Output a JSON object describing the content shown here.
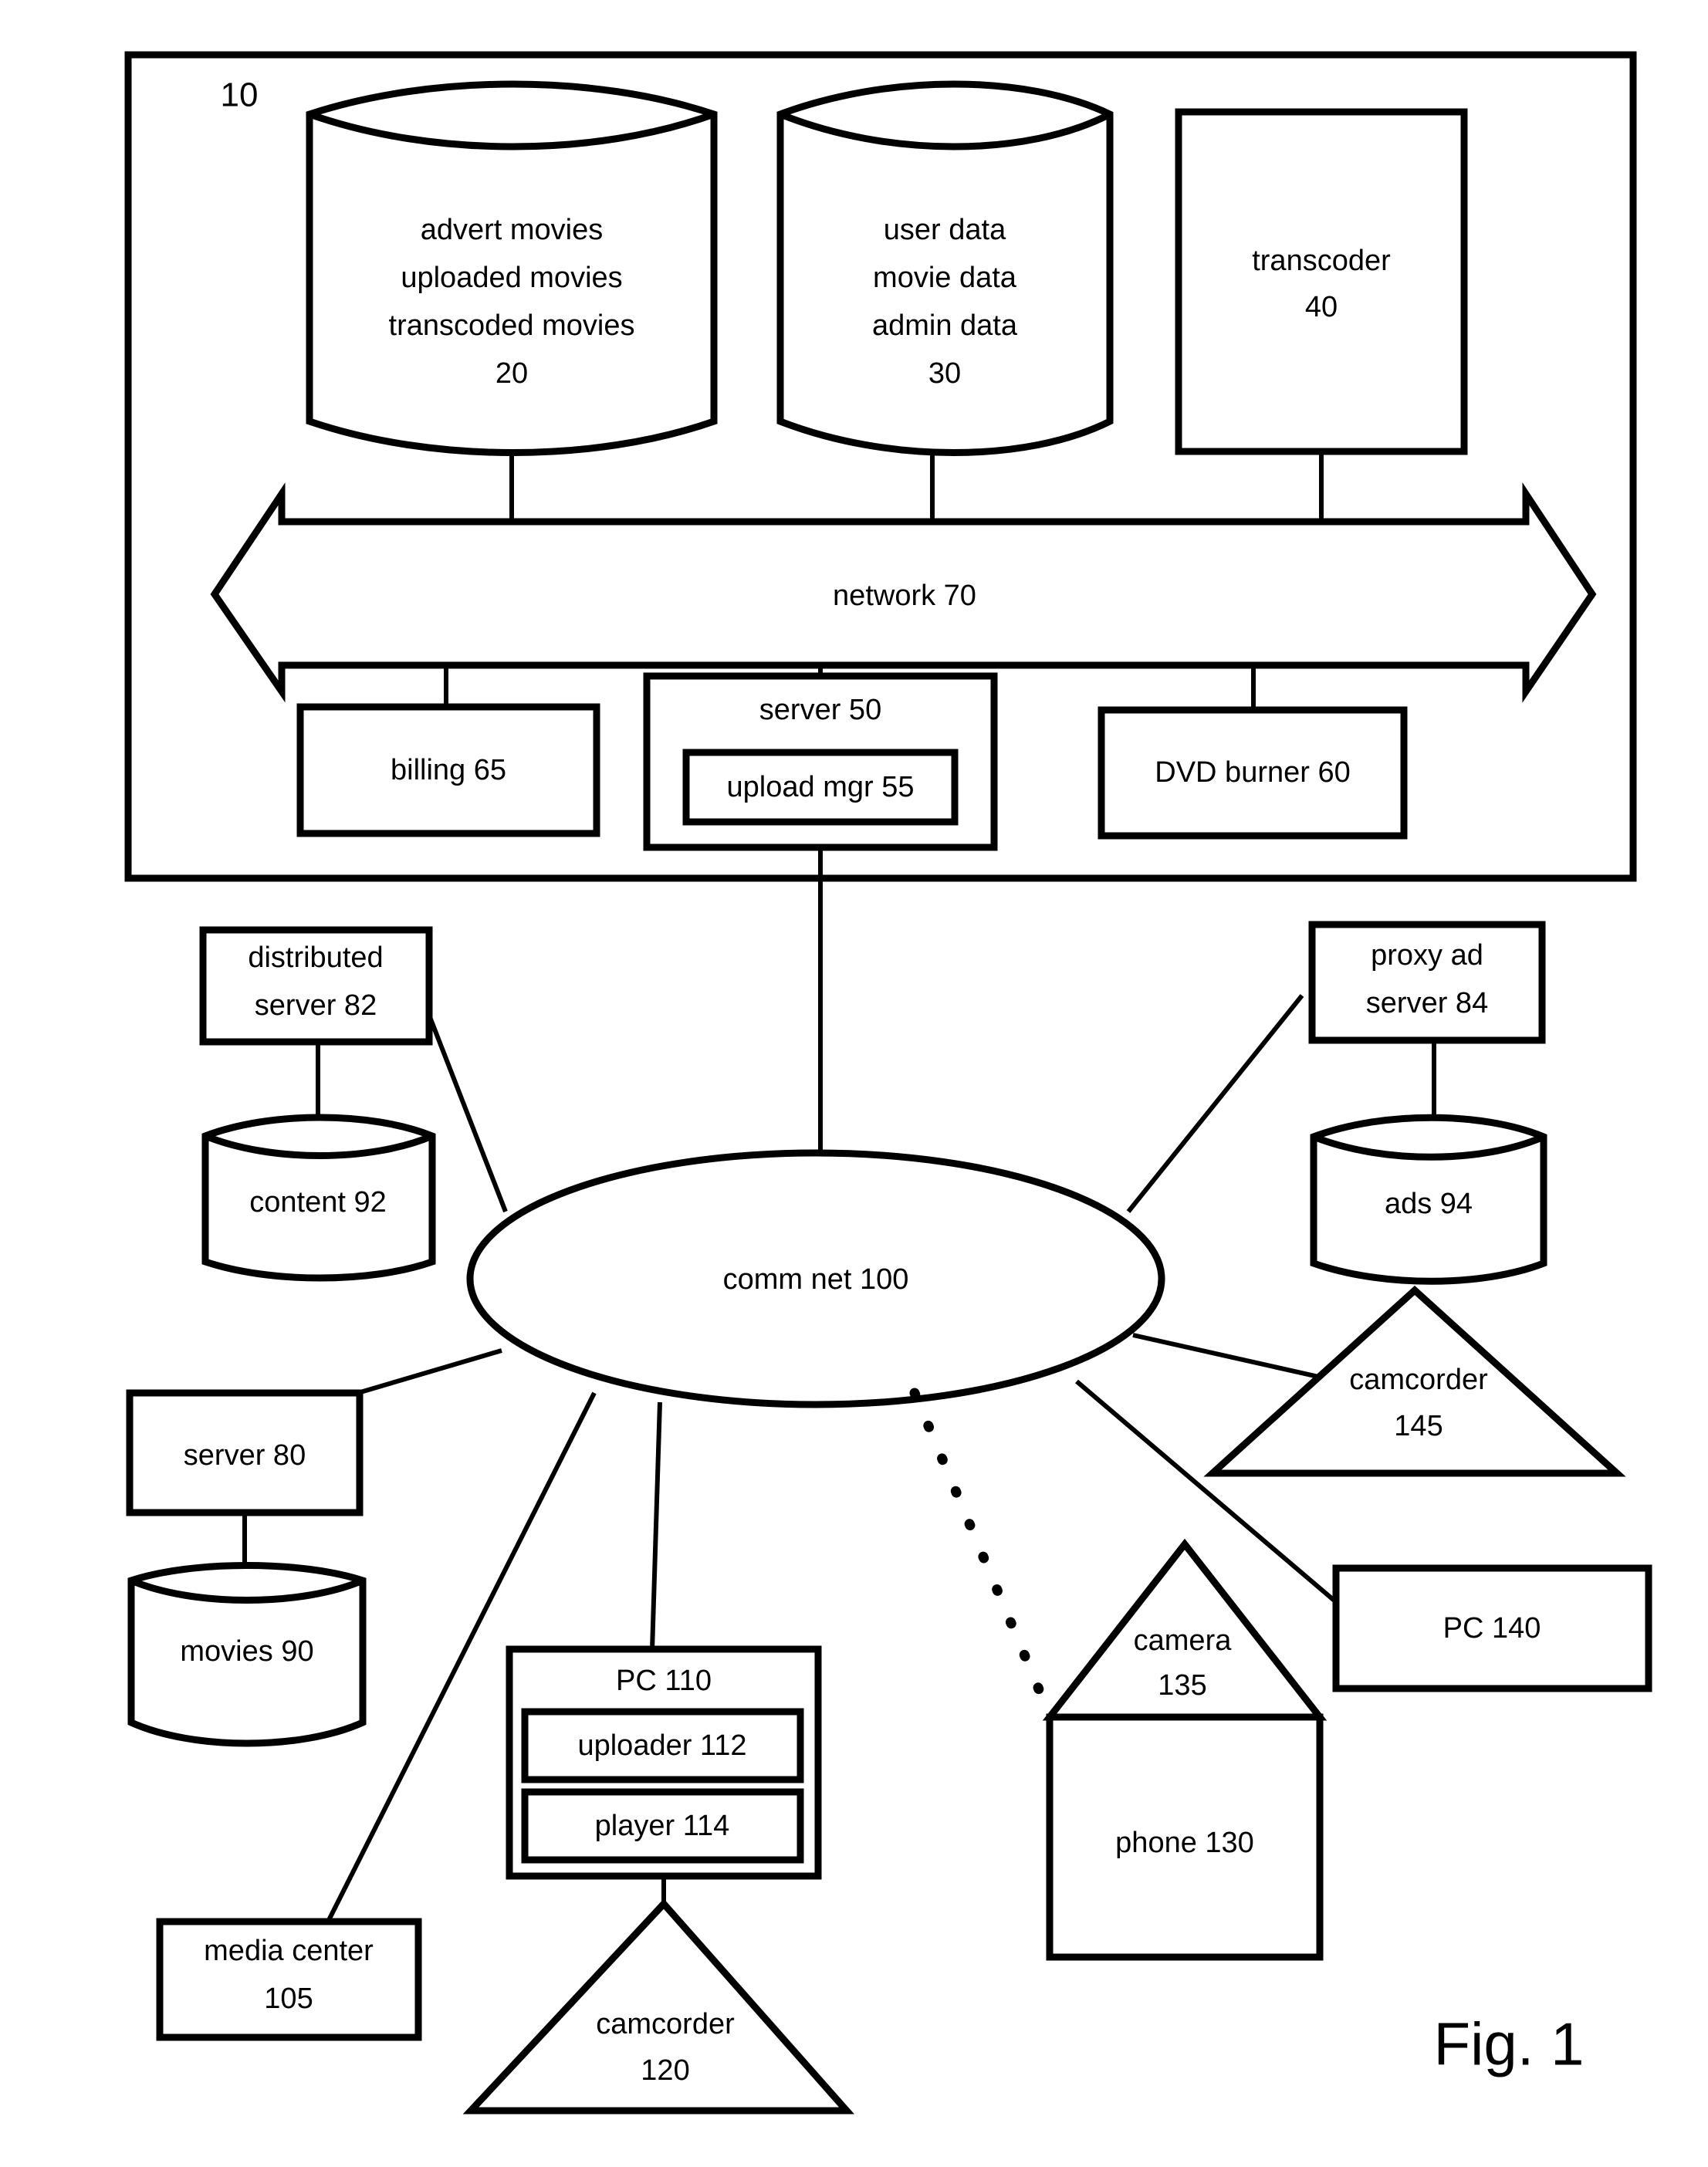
{
  "figure": {
    "caption": "Fig. 1",
    "system_ref": "10"
  },
  "system_box": {
    "ref_label": "10",
    "network_bus_label": "network 70"
  },
  "nodes": {
    "store_movies": {
      "kind": "cylinder",
      "lines": [
        "advert movies",
        "uploaded movies",
        "transcoded movies",
        "20"
      ]
    },
    "store_userdata": {
      "kind": "cylinder",
      "lines": [
        "user data",
        "movie data",
        "admin data",
        "30"
      ]
    },
    "transcoder": {
      "kind": "rect",
      "lines": [
        "transcoder",
        "40"
      ]
    },
    "billing": {
      "kind": "rect",
      "lines": [
        "billing 65"
      ]
    },
    "server_50": {
      "kind": "rect",
      "lines": [
        "server 50"
      ]
    },
    "upload_mgr": {
      "kind": "rect",
      "lines": [
        "upload mgr 55"
      ]
    },
    "dvd_burner": {
      "kind": "rect",
      "lines": [
        "DVD burner 60"
      ]
    },
    "distributed_server": {
      "kind": "rect",
      "lines": [
        "distributed",
        "server 82"
      ]
    },
    "content": {
      "kind": "cylinder",
      "lines": [
        "content 92"
      ]
    },
    "proxy_ad_server": {
      "kind": "rect",
      "lines": [
        "proxy ad",
        "server 84"
      ]
    },
    "ads": {
      "kind": "cylinder",
      "lines": [
        "ads 94"
      ]
    },
    "comm_net": {
      "kind": "ellipse",
      "lines": [
        "comm net 100"
      ]
    },
    "server_80": {
      "kind": "rect",
      "lines": [
        "server 80"
      ]
    },
    "movies": {
      "kind": "cylinder",
      "lines": [
        "movies 90"
      ]
    },
    "media_center": {
      "kind": "rect",
      "lines": [
        "media center",
        "105"
      ]
    },
    "pc_110": {
      "kind": "rect",
      "lines": [
        "PC 110"
      ]
    },
    "uploader": {
      "kind": "rect",
      "lines": [
        "uploader 112"
      ]
    },
    "player": {
      "kind": "rect",
      "lines": [
        "player 114"
      ]
    },
    "camcorder_120": {
      "kind": "triangle",
      "lines": [
        "camcorder",
        "120"
      ]
    },
    "phone": {
      "kind": "rect",
      "lines": [
        "phone 130"
      ]
    },
    "camera_135": {
      "kind": "triangle",
      "lines": [
        "camera",
        "135"
      ]
    },
    "pc_140": {
      "kind": "rect",
      "lines": [
        "PC 140"
      ]
    },
    "camcorder_145": {
      "kind": "triangle",
      "lines": [
        "camcorder",
        "145"
      ]
    }
  },
  "colors": {
    "ink": "#000000",
    "paper": "#ffffff"
  }
}
